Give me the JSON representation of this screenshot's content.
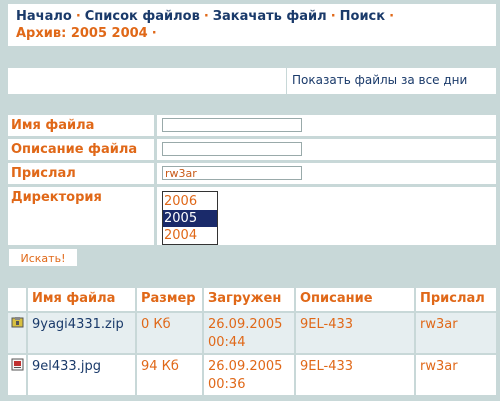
{
  "nav": {
    "items": [
      "Начало",
      "Список файлов",
      "Закачать файл",
      "Поиск"
    ],
    "separator": "·",
    "archive_label": "Архив:",
    "archive_years": "2005 2004"
  },
  "all_days_link": "Показать файлы за все дни",
  "search_form": {
    "filename_label": "Имя файла",
    "filename_value": "",
    "description_label": "Описание файла",
    "description_value": "",
    "uploader_label": "Прислал",
    "uploader_value": "rw3ar",
    "directory_label": "Директория",
    "directory_options": [
      "2006",
      "2005",
      "2004"
    ],
    "directory_selected": "2005",
    "search_button": "Искать!"
  },
  "results": {
    "headers": [
      "Имя файла",
      "Размер",
      "Загружен",
      "Описание",
      "Прислал"
    ],
    "rows": [
      {
        "icon": "zip-file-icon",
        "name": "9yagi4331.zip",
        "size": "0 Кб",
        "uploaded": "26.09.2005 00:44",
        "description": "9EL-433",
        "uploader": "rw3ar"
      },
      {
        "icon": "image-file-icon",
        "name": "9el433.jpg",
        "size": "94 Кб",
        "uploaded": "26.09.2005 00:36",
        "description": "9EL-433",
        "uploader": "rw3ar"
      }
    ]
  },
  "colors": {
    "accent": "#e06818",
    "link": "#1a3a6a",
    "background": "#c8d8d8",
    "selection": "#1a2a6a"
  }
}
